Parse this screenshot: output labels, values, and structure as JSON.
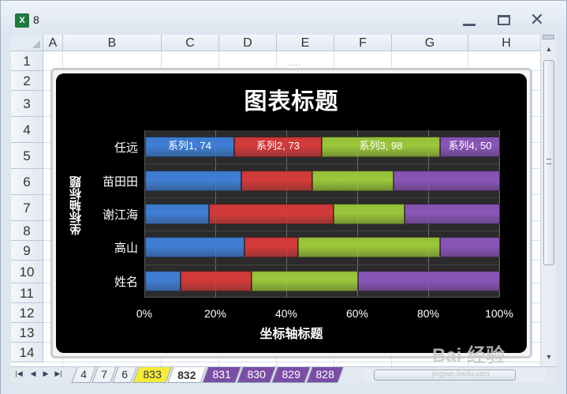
{
  "window": {
    "title": "8"
  },
  "columns": [
    "A",
    "B",
    "C",
    "D",
    "E",
    "F",
    "G",
    "H"
  ],
  "rows": [
    "1",
    "2",
    "3",
    "4",
    "5",
    "6",
    "7",
    "8",
    "9",
    "10",
    "11",
    "12",
    "13",
    "14"
  ],
  "chart_data": {
    "type": "bar",
    "stacked": "percent",
    "orientation": "horizontal",
    "title": "图表标题",
    "xlabel": "坐标轴标题",
    "ylabel": "坐标轴标题",
    "categories": [
      "任远",
      "苗田田",
      "谢江海",
      "高山",
      "姓名"
    ],
    "x_ticks": [
      "0%",
      "20%",
      "40%",
      "60%",
      "80%",
      "100%"
    ],
    "xlim": [
      0,
      100
    ],
    "series": [
      {
        "name": "系列1",
        "color": "#3f7fd6",
        "values": [
          74,
          27,
          18,
          28,
          10
        ]
      },
      {
        "name": "系列2",
        "color": "#d63a3a",
        "values": [
          73,
          20,
          35,
          15,
          20
        ]
      },
      {
        "name": "系列3",
        "color": "#9cc83a",
        "values": [
          98,
          23,
          20,
          40,
          30
        ]
      },
      {
        "name": "系列4",
        "color": "#8a55b8",
        "values": [
          50,
          30,
          27,
          17,
          40
        ]
      }
    ],
    "data_labels": [
      "系列1, 74",
      "系列2, 73",
      "系列3, 98",
      "系列4, 50"
    ],
    "grid": true,
    "background": "#000000"
  },
  "sheet_tabs": [
    {
      "label": "4",
      "style": "plain"
    },
    {
      "label": "7",
      "style": "plain"
    },
    {
      "label": "6",
      "style": "plain"
    },
    {
      "label": "833",
      "style": "yellow"
    },
    {
      "label": "832",
      "style": "active"
    },
    {
      "label": "831",
      "style": "purple"
    },
    {
      "label": "830",
      "style": "purple"
    },
    {
      "label": "829",
      "style": "purple"
    },
    {
      "label": "828",
      "style": "purple"
    }
  ],
  "watermark": {
    "text": "Bai 经验",
    "sub": "jingyan.baidu.com"
  }
}
